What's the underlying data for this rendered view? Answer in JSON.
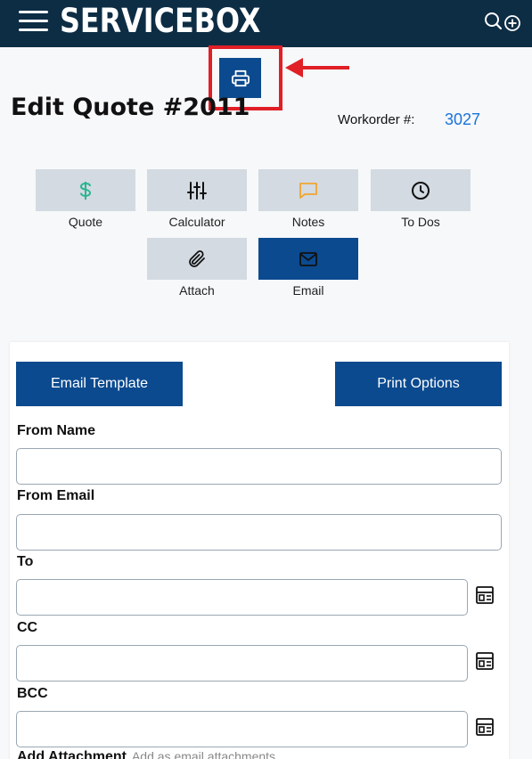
{
  "header": {
    "brand": "SERVICEBOX",
    "menu_icon": "hamburger-menu-icon",
    "search_icon": "search-icon",
    "add_icon": "plus-circle-icon",
    "background_color": "#0d2d45"
  },
  "toolbar": {
    "print_icon": "printer-icon",
    "accent_color": "#0b4a8f",
    "highlight_color": "#e01f26"
  },
  "page": {
    "title": "Edit Quote #2011",
    "workorder_label": "Workorder #:",
    "workorder_value": "3027"
  },
  "tabs": [
    {
      "label": "Quote",
      "icon": "dollar-icon",
      "active": false
    },
    {
      "label": "Calculator",
      "icon": "sliders-icon",
      "active": false
    },
    {
      "label": "Notes",
      "icon": "chat-bubble-icon",
      "active": false
    },
    {
      "label": "To Dos",
      "icon": "clock-icon",
      "active": false
    },
    {
      "label": "Attach",
      "icon": "paperclip-icon",
      "active": false
    },
    {
      "label": "Email",
      "icon": "envelope-icon",
      "active": true
    }
  ],
  "email_form": {
    "email_template_button": "Email Template",
    "print_options_button": "Print Options",
    "fields": {
      "from_name": {
        "label": "From Name",
        "value": ""
      },
      "from_email": {
        "label": "From Email",
        "value": ""
      },
      "to": {
        "label": "To",
        "value": ""
      },
      "cc": {
        "label": "CC",
        "value": ""
      },
      "bcc": {
        "label": "BCC",
        "value": ""
      }
    },
    "add_attachment_label": "Add Attachment",
    "add_attachment_hint": "Add as email attachments"
  }
}
